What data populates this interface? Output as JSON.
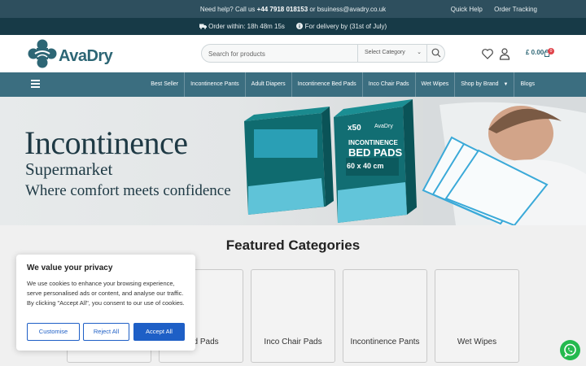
{
  "topbar": {
    "help_prefix": "Need help? Call us ",
    "phone": "+44 7918 018153",
    "help_mid": " or ",
    "email": "bsuiness@avadry.co.uk",
    "links": [
      "Quick Help",
      "Order Tracking"
    ]
  },
  "promo": {
    "order_within": "Order within: 18h 48m 15s",
    "delivery": "For delivery by (31st of July)"
  },
  "header": {
    "logo_text": "AvaDry",
    "search_placeholder": "Search for products",
    "category_label": "Select Category",
    "cart_total": "£ 0.00",
    "cart_count": "0"
  },
  "nav": {
    "items": [
      "Best Seller",
      "Incontinence Pants",
      "Adult Diapers",
      "Incontinence Bed Pads",
      "Inco Chair Pads",
      "Wet Wipes",
      "Shop by Brand",
      "Blogs"
    ]
  },
  "hero": {
    "line1": "Incontinence",
    "line2": "Supermarket",
    "line3": "Where comfort meets confidence",
    "box_count": "x50",
    "box_brand": "AvaDry",
    "box_title_1": "INCONTINENCE",
    "box_title_2": "BED PADS",
    "box_size": "60 x 40 cm"
  },
  "featured": {
    "title": "Featured Categories",
    "categories": [
      "Bed Pads",
      "Inco Chair Pads",
      "Incontinence Pants",
      "Wet Wipes"
    ]
  },
  "cookie": {
    "title": "We value your privacy",
    "text": "We use cookies to enhance your browsing experience, serve personalised ads or content, and analyse our traffic. By clicking \"Accept All\", you consent to our use of cookies.",
    "customise": "Customise",
    "reject": "Reject All",
    "accept": "Accept All"
  },
  "colors": {
    "topbar": "#2e4f5e",
    "promo": "#173a47",
    "nav": "#3b6e80",
    "brand": "#2d6675",
    "button_blue": "#1e5fc6",
    "whatsapp": "#25b94e"
  }
}
